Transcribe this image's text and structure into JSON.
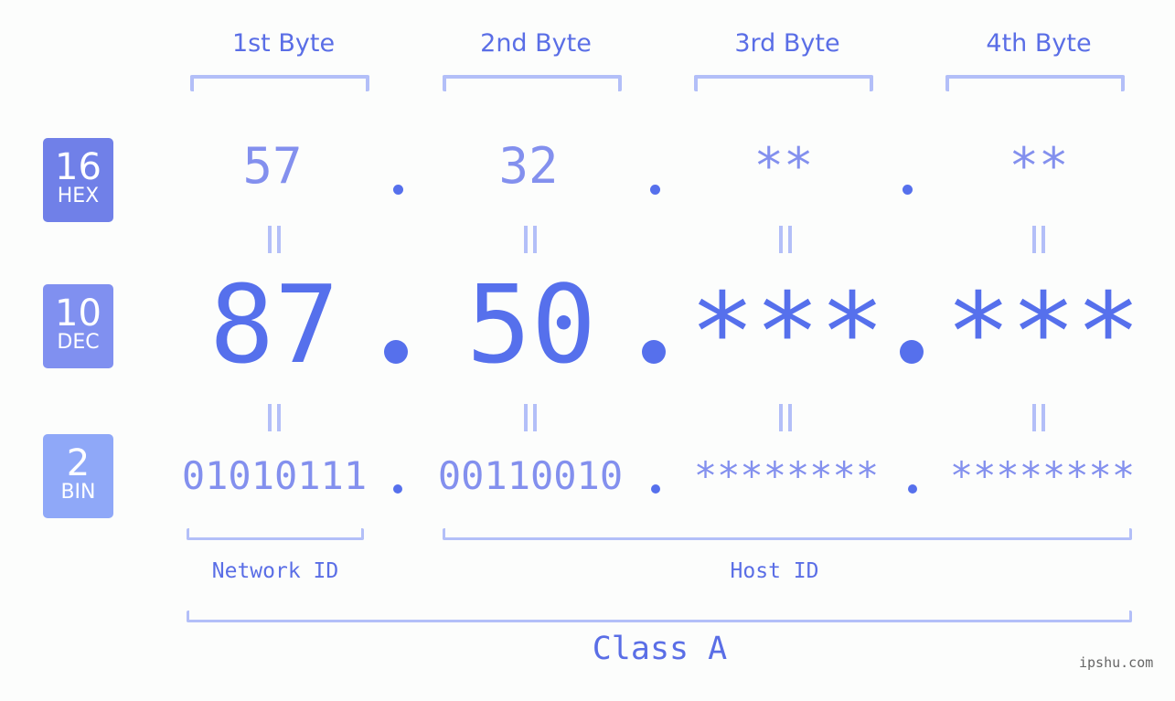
{
  "bases": [
    {
      "number": "16",
      "label": "HEX",
      "color": "#7080e8"
    },
    {
      "number": "10",
      "label": "DEC",
      "color": "#8090f0"
    },
    {
      "number": "2",
      "label": "BIN",
      "color": "#8fa8f8"
    }
  ],
  "byte_headers": [
    "1st Byte",
    "2nd Byte",
    "3rd Byte",
    "4th Byte"
  ],
  "hex_values": [
    "57",
    "32",
    "**",
    "**"
  ],
  "dec_values": [
    "87",
    "50",
    "***",
    "***"
  ],
  "bin_values": [
    "01010111",
    "00110010",
    "********",
    "********"
  ],
  "separator": ".",
  "parts": {
    "network_id": "Network ID",
    "host_id": "Host ID"
  },
  "ip_class": "Class A",
  "watermark": "ipshu.com",
  "colors": {
    "primary": "#5670ec",
    "secondary": "#8390ee",
    "bracket": "#b3bff8",
    "background": "#fcfdfc"
  }
}
